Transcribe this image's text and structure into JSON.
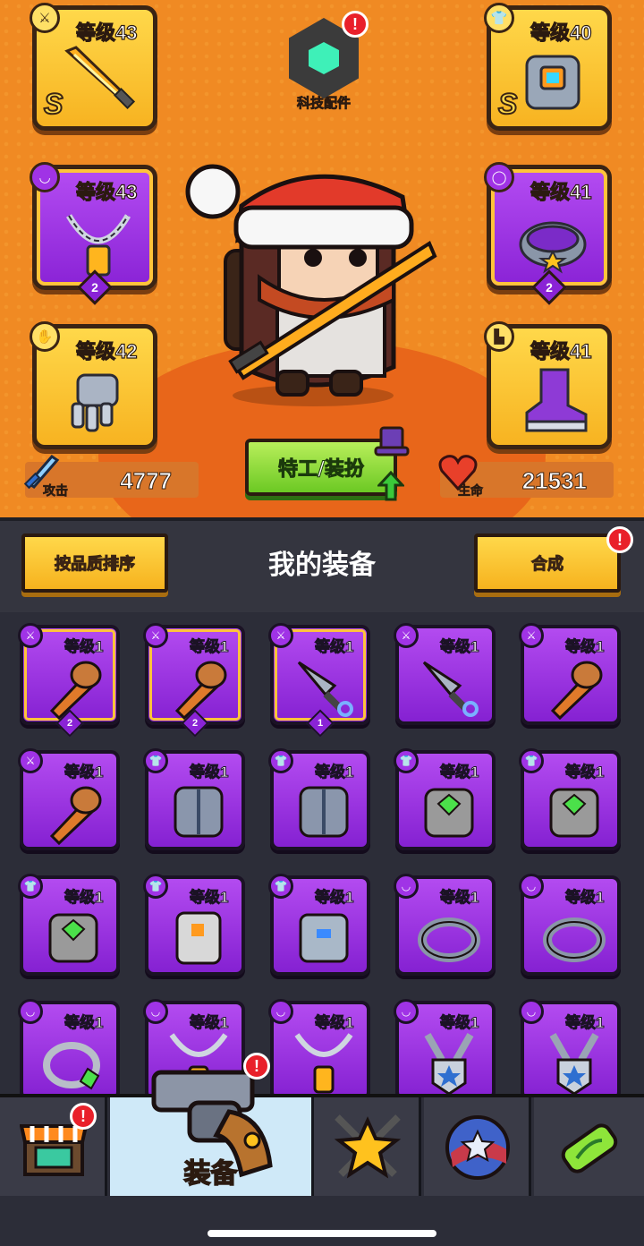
{
  "hero_slots": {
    "weapon": {
      "level": "等级43",
      "rank": "S",
      "icon": "dagger-category-icon",
      "art": "flame-sword"
    },
    "armor": {
      "level": "等级40",
      "rank": "S",
      "icon": "shirt-category-icon",
      "art": "mech-armor"
    },
    "necklace": {
      "level": "等级43",
      "stars": "2",
      "icon": "necklace-category-icon",
      "art": "chain-necklace"
    },
    "belt": {
      "level": "等级41",
      "stars": "2",
      "icon": "belt-category-icon",
      "art": "spiked-belt"
    },
    "glove": {
      "level": "等级42",
      "icon": "glove-category-icon",
      "art": "robot-gauntlet"
    },
    "boots": {
      "level": "等级41",
      "icon": "boot-category-icon",
      "art": "purple-boot"
    }
  },
  "tech_parts": {
    "label": "科技配件",
    "alert": "!"
  },
  "stats": {
    "attack": {
      "label": "攻击",
      "value": "4777"
    },
    "hp": {
      "label": "生命",
      "value": "21531"
    }
  },
  "agent_button": {
    "label": "特工/装扮"
  },
  "panel": {
    "sort_button": "按品质排序",
    "title": "我的装备",
    "merge_button": "合成",
    "merge_alert": "!"
  },
  "inventory": [
    {
      "level": "等级1",
      "cat": "dagger",
      "art": "torch",
      "stars": "2",
      "rare": true
    },
    {
      "level": "等级1",
      "cat": "dagger",
      "art": "torch",
      "stars": "2",
      "rare": true
    },
    {
      "level": "等级1",
      "cat": "dagger",
      "art": "kunai",
      "stars": "1",
      "rare": true
    },
    {
      "level": "等级1",
      "cat": "dagger",
      "art": "kunai",
      "stars": "",
      "rare": false
    },
    {
      "level": "等级1",
      "cat": "dagger",
      "art": "torch",
      "stars": "",
      "rare": false
    },
    {
      "level": "等级1",
      "cat": "dagger",
      "art": "torch",
      "stars": "",
      "rare": false
    },
    {
      "level": "等级1",
      "cat": "shirt",
      "art": "steel-armor",
      "stars": "",
      "rare": false
    },
    {
      "level": "等级1",
      "cat": "shirt",
      "art": "steel-armor",
      "stars": "",
      "rare": false
    },
    {
      "level": "等级1",
      "cat": "shirt",
      "art": "gem-vest",
      "stars": "",
      "rare": false
    },
    {
      "level": "等级1",
      "cat": "shirt",
      "art": "gem-vest",
      "stars": "",
      "rare": false
    },
    {
      "level": "等级1",
      "cat": "shirt",
      "art": "gem-vest",
      "stars": "",
      "rare": false
    },
    {
      "level": "等级1",
      "cat": "shirt",
      "art": "plate-vest",
      "stars": "",
      "rare": false
    },
    {
      "level": "等级1",
      "cat": "shirt",
      "art": "blue-vest",
      "stars": "",
      "rare": false
    },
    {
      "level": "等级1",
      "cat": "necklace",
      "art": "spike-collar",
      "stars": "",
      "rare": false
    },
    {
      "level": "等级1",
      "cat": "necklace",
      "art": "spike-collar",
      "stars": "",
      "rare": false
    },
    {
      "level": "等级1",
      "cat": "necklace",
      "art": "gem-ring",
      "stars": "",
      "rare": false
    },
    {
      "level": "等级1",
      "cat": "necklace",
      "art": "chain-necklace",
      "stars": "",
      "rare": false
    },
    {
      "level": "等级1",
      "cat": "necklace",
      "art": "chain-necklace",
      "stars": "",
      "rare": false
    },
    {
      "level": "等级1",
      "cat": "necklace",
      "art": "star-medal",
      "stars": "",
      "rare": false
    },
    {
      "level": "等级1",
      "cat": "necklace",
      "art": "star-medal",
      "stars": "",
      "rare": false
    }
  ],
  "nav": {
    "shop": {
      "icon": "shop-icon",
      "alert": "!"
    },
    "equipment": {
      "label": "装备",
      "icon": "revolver-icon",
      "alert": "!"
    },
    "talents": {
      "icon": "star-swords-icon"
    },
    "pets": {
      "icon": "star-ball-icon"
    },
    "evolve": {
      "icon": "dna-capsule-icon"
    }
  },
  "colors": {
    "orange_bg": "#f08a23",
    "purple_item": "#9a31e2",
    "gold_item": "#ffd84a",
    "green_button": "#7fd432",
    "alert_red": "#e9202a"
  }
}
